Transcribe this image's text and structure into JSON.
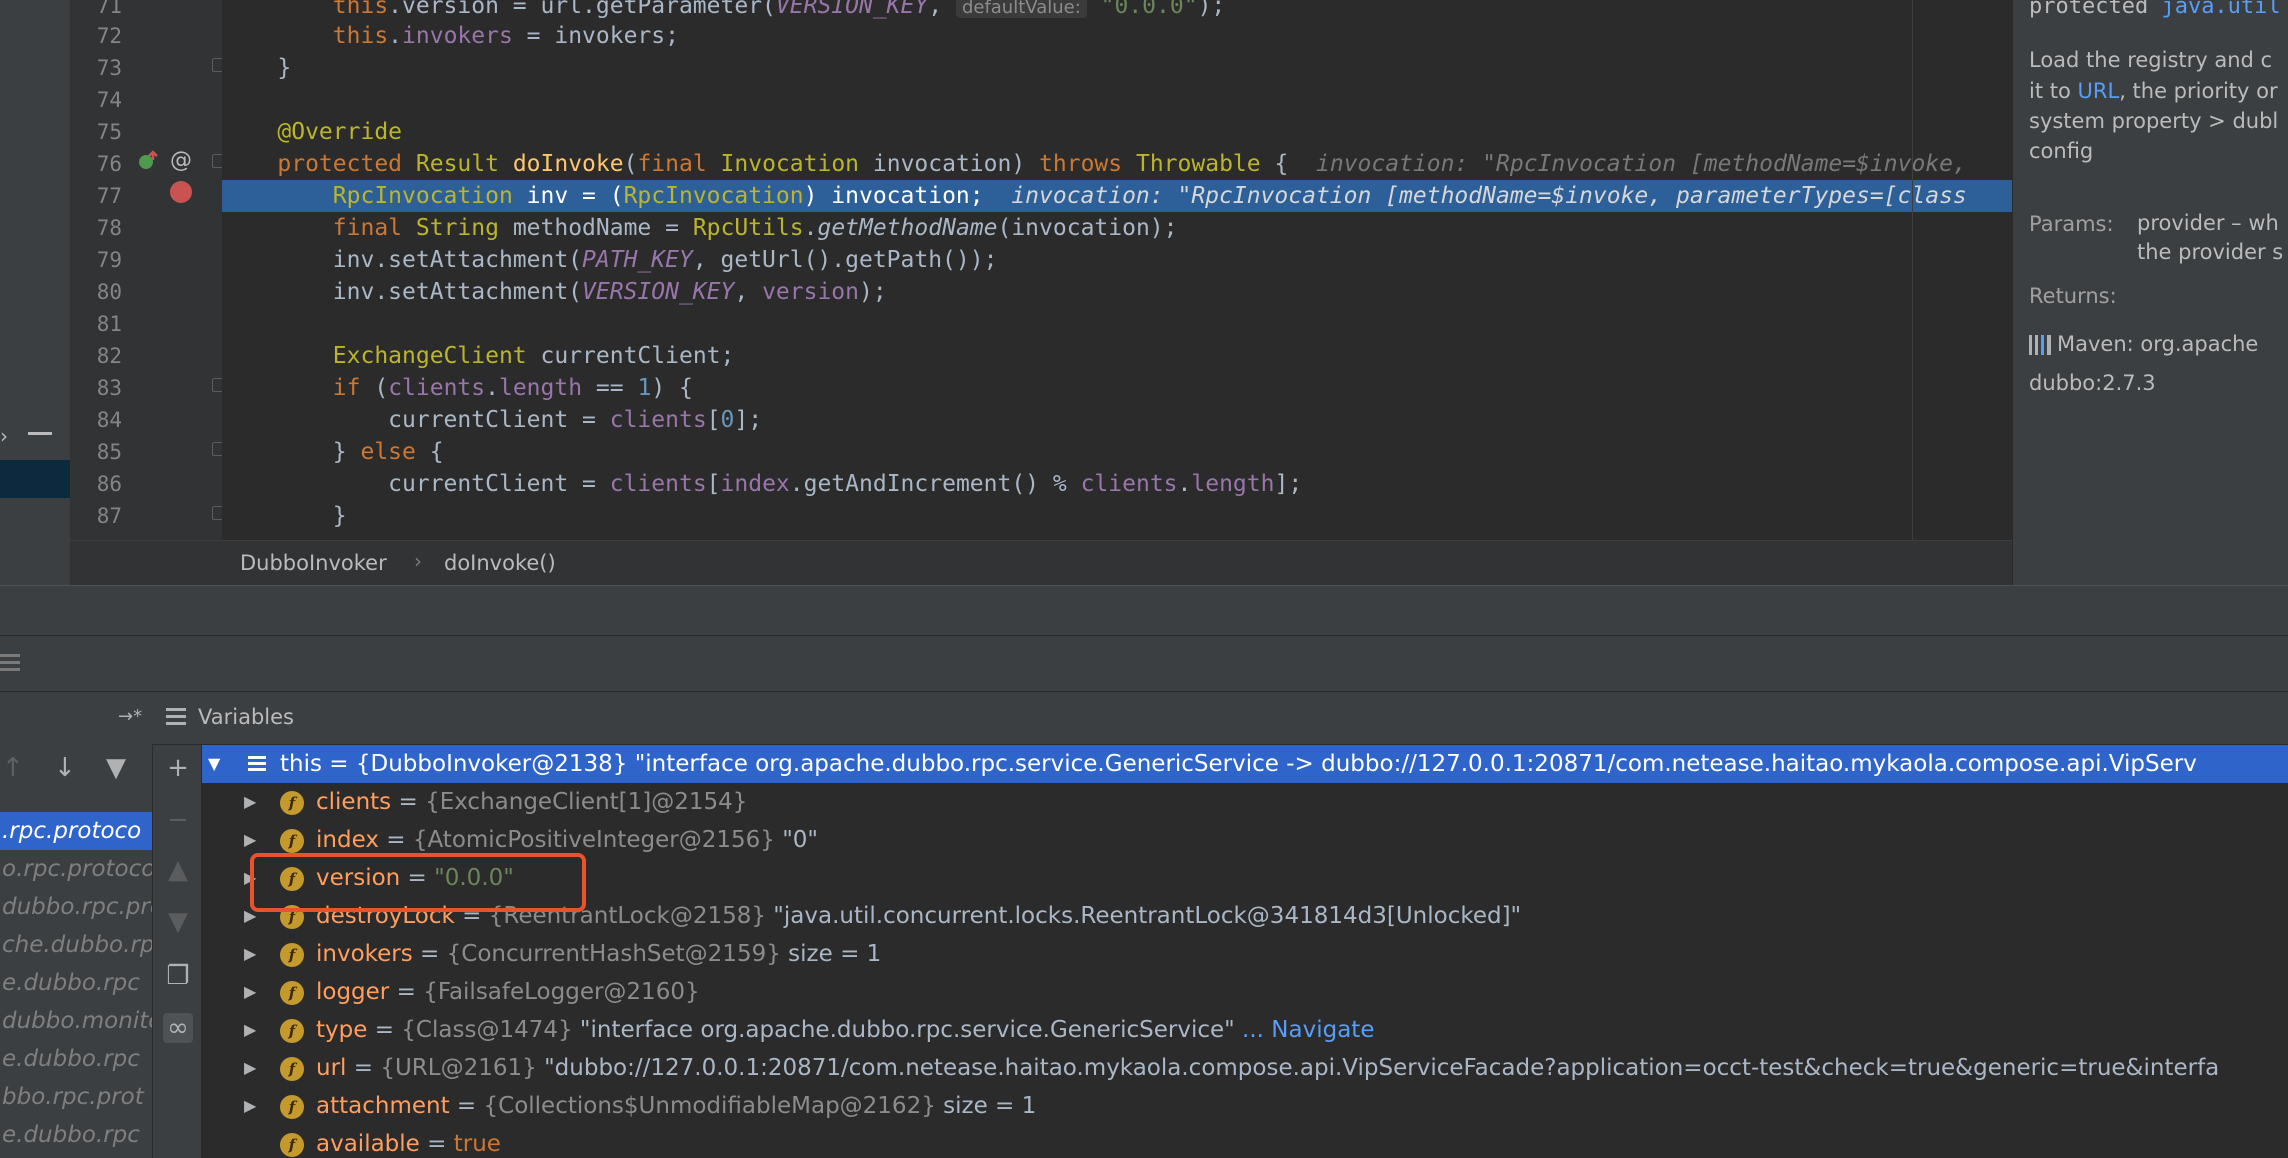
{
  "editor": {
    "line_numbers": [
      "71",
      "72",
      "73",
      "74",
      "75",
      "76",
      "77",
      "78",
      "79",
      "80",
      "81",
      "82",
      "83",
      "84",
      "85",
      "86",
      "87"
    ],
    "lines": {
      "l71": {
        "a": "this",
        "b": ".version = url.getParameter(",
        "c": "VERSION_KEY",
        "d": ", ",
        "hint": "defaultValue:",
        "e": "\"0.0.0\"",
        "f": ");"
      },
      "l72": {
        "a": "this",
        "b": ".",
        "c": "invokers",
        "d": " = invokers;"
      },
      "l73": {
        "a": "}"
      },
      "l75": {
        "a": "@Override"
      },
      "l76": {
        "a": "protected ",
        "b": "Result ",
        "c": "doInvoke",
        "d": "(",
        "e": "final ",
        "f": "Invocation ",
        "g": "invocation) ",
        "h": "throws ",
        "i": "Throwable ",
        "j": "{  ",
        "hint": "invocation: \"RpcInvocation [methodName=$invoke,"
      },
      "l77": {
        "a": "RpcInvocation",
        "b": " inv = (",
        "c": "RpcInvocation",
        "d": ") invocation;  ",
        "hint": "invocation: \"RpcInvocation [methodName=$invoke, parameterTypes=[class"
      },
      "l78": {
        "a": "final ",
        "b": "String ",
        "c": "methodName = ",
        "d": "RpcUtils",
        "e": ".",
        "f": "getMethodName",
        "g": "(invocation);"
      },
      "l79": {
        "a": "inv.setAttachment(",
        "b": "PATH_KEY",
        "c": ", getUrl().getPath());"
      },
      "l80": {
        "a": "inv.setAttachment(",
        "b": "VERSION_KEY",
        "c": ", ",
        "d": "version",
        "e": ");"
      },
      "l82": {
        "a": "ExchangeClient ",
        "b": "currentClient;"
      },
      "l83": {
        "a": "if ",
        "b": "(",
        "c": "clients",
        "d": ".",
        "e": "length",
        "f": " == ",
        "g": "1",
        "h": ") {"
      },
      "l84": {
        "a": "currentClient = ",
        "b": "clients",
        "c": "[",
        "d": "0",
        "e": "];"
      },
      "l85": {
        "a": "} ",
        "b": "else ",
        "c": "{"
      },
      "l86": {
        "a": "currentClient = ",
        "b": "clients",
        "c": "[",
        "d": "index",
        "e": ".getAndIncrement() % ",
        "f": "clients",
        "g": ".",
        "h": "length",
        "i": "];"
      },
      "l87": {
        "a": "}"
      }
    },
    "breadcrumb": [
      "DubboInvoker",
      "doInvoke()"
    ]
  },
  "doc": {
    "head_kw": "protected ",
    "head_type": "java.util",
    "body_lines": [
      "Load the registry and c",
      "it to ",
      "URL",
      ", the priority or",
      "system property > dubl",
      "config"
    ],
    "params_label": "Params:",
    "params_lines": [
      "provider – wh",
      "the provider s"
    ],
    "returns_label": "Returns:",
    "maven": "Maven: org.apache",
    "maven_version": "dubbo:2.7.3"
  },
  "debugger": {
    "variables_title": "Variables",
    "frames": [
      ".rpc.protoco",
      "o.rpc.protoco",
      "dubbo.rpc.pro",
      "che.dubbo.rp",
      "e.dubbo.rpc",
      "dubbo.monito",
      "e.dubbo.rpc",
      "bbo.rpc.prot",
      "e.dubbo.rpc"
    ],
    "this_row": {
      "name": "this",
      "eq": " = ",
      "type": "{DubboInvoker@2138}",
      "value": " \"interface org.apache.dubbo.rpc.service.GenericService -> dubbo://127.0.0.1:20871/com.netease.haitao.mykaola.compose.api.VipServ"
    },
    "fields": [
      {
        "name": "clients",
        "eq": " = ",
        "type": "{ExchangeClient[1]@2154}",
        "value": "",
        "extra": ""
      },
      {
        "name": "index",
        "eq": " = ",
        "type": "{AtomicPositiveInteger@2156}",
        "value": " \"0\"",
        "extra": ""
      },
      {
        "name": "version",
        "eq": " = ",
        "type": "",
        "value": "\"0.0.0\"",
        "extra": ""
      },
      {
        "name": "destroyLock",
        "eq": " = ",
        "type": "{ReentrantLock@2158}",
        "value": " \"java.util.concurrent.locks.ReentrantLock@341814d3[Unlocked]\"",
        "extra": ""
      },
      {
        "name": "invokers",
        "eq": " = ",
        "type": "{ConcurrentHashSet@2159}",
        "value": "  size = 1",
        "extra": ""
      },
      {
        "name": "logger",
        "eq": " = ",
        "type": "{FailsafeLogger@2160}",
        "value": "",
        "extra": ""
      },
      {
        "name": "type",
        "eq": " = ",
        "type": "{Class@1474}",
        "value": " \"interface org.apache.dubbo.rpc.service.GenericService\"",
        "extra": " ... Navigate"
      },
      {
        "name": "url",
        "eq": " = ",
        "type": "{URL@2161}",
        "value": " \"dubbo://127.0.0.1:20871/com.netease.haitao.mykaola.compose.api.VipServiceFacade?application=occt-test&check=true&generic=true&interfa",
        "extra": ""
      },
      {
        "name": "attachment",
        "eq": " = ",
        "type": "{Collections$UnmodifiableMap@2162}",
        "value": "  size = 1",
        "extra": ""
      },
      {
        "name": "available",
        "eq": " = ",
        "type": "",
        "value": "true",
        "extra": ""
      }
    ]
  },
  "colors": {
    "selection": "#2f65ca",
    "highlight_box": "#e8532c",
    "field_icon": "#c49a2f"
  }
}
